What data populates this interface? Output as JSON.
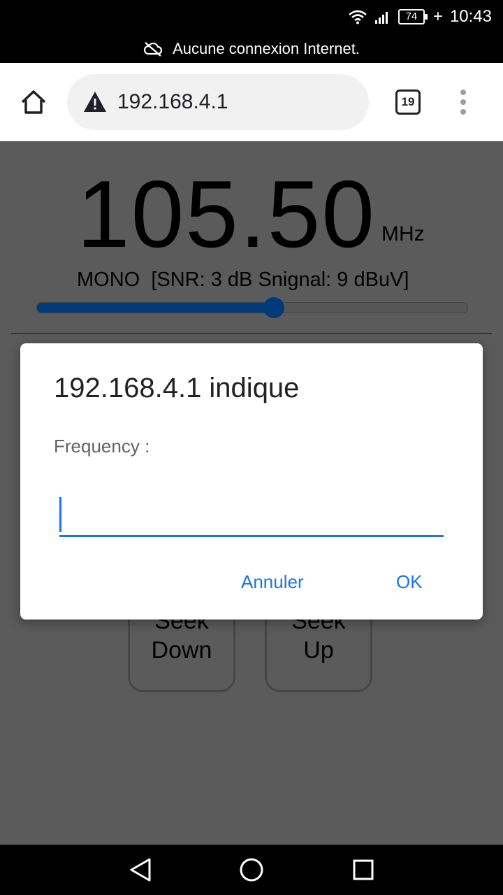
{
  "status_bar": {
    "battery": "74",
    "time": "10:43"
  },
  "notice": {
    "text": "Aucune connexion Internet."
  },
  "browser": {
    "url": "192.168.4.1",
    "tab_count": "19"
  },
  "page": {
    "frequency": "105.50",
    "unit": "MHz",
    "signal_info": "MONO  [SNR: 3 dB Snignal: 9 dBuV]",
    "slider_fraction": 0.55,
    "seek_down_line1": "Seek",
    "seek_down_line2": "Down",
    "seek_up_line1": "Seek",
    "seek_up_line2": "Up"
  },
  "dialog": {
    "title": "192.168.4.1 indique",
    "message": "Frequency :",
    "input_value": "",
    "cancel_label": "Annuler",
    "ok_label": "OK"
  },
  "colors": {
    "accent": "#1a73e8",
    "slider": "#003a78"
  }
}
